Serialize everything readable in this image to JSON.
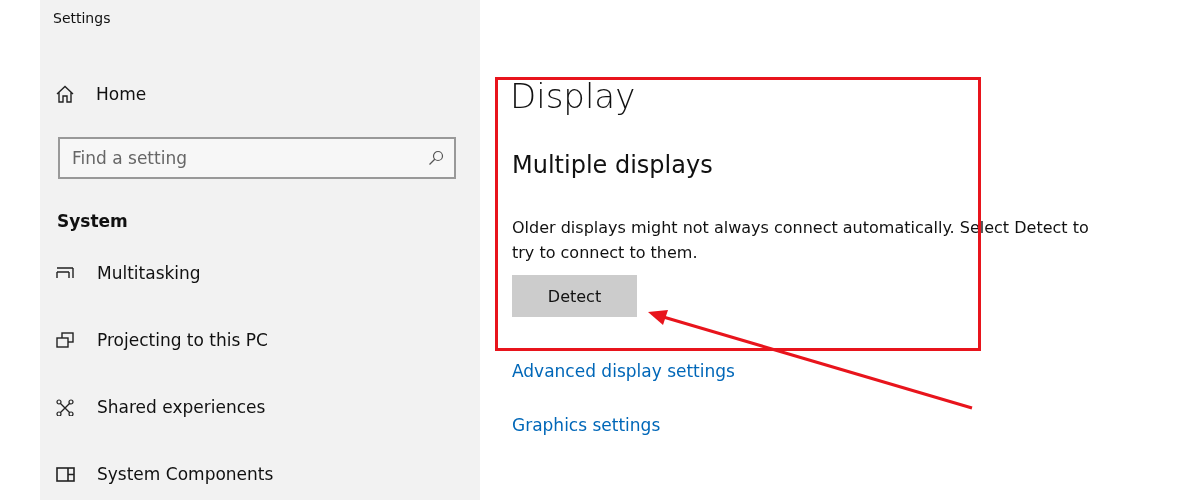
{
  "window": {
    "title": "Settings"
  },
  "sidebar": {
    "home": {
      "label": "Home"
    },
    "search": {
      "placeholder": "Find a setting"
    },
    "section": "System",
    "items": [
      {
        "label": "Multitasking"
      },
      {
        "label": "Projecting to this PC"
      },
      {
        "label": "Shared experiences"
      },
      {
        "label": "System Components"
      }
    ]
  },
  "content": {
    "title": "Display",
    "subtitle": "Multiple displays",
    "description": "Older displays might not always connect automatically. Select Detect to try to connect to them.",
    "button": "Detect",
    "links": [
      "Advanced display settings",
      "Graphics settings"
    ]
  },
  "annotations": {
    "highlight_box": true,
    "arrow": true
  }
}
